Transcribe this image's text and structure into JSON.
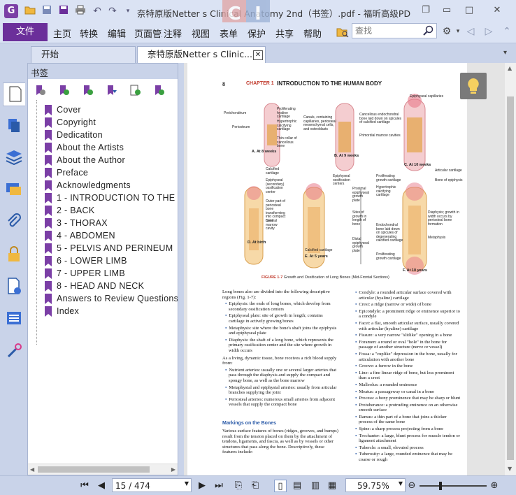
{
  "window": {
    "title": "奈特原版Netter s Clinical Anatomy 2nd（书签）.pdf - 福昕高级PDF编...",
    "watermark": [
      "C",
      "I"
    ]
  },
  "menu": {
    "file": "文件",
    "items": [
      "主页",
      "转换",
      "编辑",
      "页面管理",
      "注释",
      "视图",
      "表单",
      "保护",
      "共享",
      "帮助"
    ],
    "search_placeholder": "查找"
  },
  "tabs": [
    {
      "label": "开始",
      "active": false
    },
    {
      "label": "奈特原版Netter s Clinic...",
      "active": true
    }
  ],
  "bookmarks_panel": {
    "title": "书签",
    "items": [
      "Cover",
      "Copyright",
      "Dedicatiton",
      "About the Artists",
      "About the Author",
      "Preface",
      "Acknowledgments",
      "1 - INTRODUCTION TO THE HU",
      "2 - BACK",
      "3 - THORAX",
      "4 - ABDOMEN",
      "5 - PELVIS AND PERINEUM",
      "6 - LOWER LIMB",
      "7 - UPPER LIMB",
      "8 - HEAD AND NECK",
      "Answers to Review Questions",
      "Index"
    ]
  },
  "page": {
    "number": "8",
    "chapter": "CHAPTER 1",
    "chapter_title": "INTRODUCTION TO THE HUMAN BODY",
    "figure_caption_label": "FIGURE 1-7",
    "figure_caption": " Growth and Ossification of Long Bones (Mid-Frontal Sections)",
    "fig_labels": {
      "a": "A. At 8 weeks",
      "b": "B. At 9 weeks",
      "c": "C. At 10 weeks",
      "d": "D. At birth",
      "e": "E. At 5 years",
      "f": "F. At 10 years",
      "perichondrium": "Perichondrium",
      "periosteum": "Periosteum",
      "prolif": "Proliferating hyaline cartilage",
      "hyper": "Hypertrophic calcifying cartilage",
      "thincollar": "Thin collar of cancellous bone",
      "canals": "Canals, containing capillaries, periosteal mesenchymal cells, and osteoblasts",
      "cancellous": "Cancellous endochondral bone laid down on spicules of calcified cartilage",
      "primordial": "Primordial marrow cavities",
      "epicap": "Epiphyseal capillaries",
      "calcified": "Calcified cartilage",
      "epicenter": "Epiphyseal (secondary) ossification center",
      "outer": "Outer part of periosteal bone transforming into compact bone",
      "central": "Central marrow cavity",
      "epiossif": "Epiphyseal ossification centers",
      "proximal": "Proximal epiphyseal growth plate",
      "sites": "Sites of growth in length of bone",
      "distal": "Distal epiphyseal growth plate",
      "endo": "Endochondral bone laid down on spicules of degenerating calcified cartilage",
      "prolifgrowth": "Proliferating growth cartilage",
      "hypercalc": "Hypertrophic calcifying cartilage",
      "artcart": "Articular cartilage",
      "boneepi": "Bone of epiphysis",
      "diaphysis": "Diaphysis; growth in width occurs by periosteal bone formation",
      "metaphysis": "Metaphysis",
      "calc5": "Calcified cartilage",
      "prolif10": "Proliferating growth cartilage"
    },
    "left_col": {
      "intro": "Long bones also are divided into the following descriptive regions (Fig. 1-7):",
      "bullets": [
        "Epiphysis: the ends of long bones, which develop from secondary ossification centers",
        "Epiphyseal plate: site of growth in length; contains cartilage in actively growing bones",
        "Metaphysis: site where the bone's shaft joins the epiphysis and epiphyseal plate",
        "Diaphysis: the shaft of a long bone, which represents the primary ossification center and the site where growth in width occurs"
      ],
      "para2": "As a living, dynamic tissue, bone receives a rich blood supply from:",
      "bullets2": [
        "Nutrient arteries: usually one or several larger arteries that pass through the diaphysis and supply the compact and spongy bone, as well as the bone marrow",
        "Metaphysial and epiphysial arteries: usually from articular branches supplying the joint",
        "Periosteal arteries: numerous small arteries from adjacent vessels that supply the compact bone"
      ],
      "subhead": "Markings on the Bones",
      "para3": "Various surface features of bones (ridges, grooves, and bumps) result from the tension placed on them by the attachment of tendons, ligaments, and fascia, as well as by vessels or other structures that pass along the bone. Descriptively, these features include:"
    },
    "right_col": [
      "Condyle: a rounded articular surface covered with articular (hyaline) cartilage",
      "Crest: a ridge (narrow or wide) of bone",
      "Epicondyle: a prominent ridge or eminence superior to a condyle",
      "Facet: a flat, smooth articular surface, usually covered with articular (hyaline) cartilage",
      "Fissure: a very narrow \"slitlike\" opening in a bone",
      "Foramen: a round or oval \"hole\" in the bone for passage of another structure (nerve or vessel)",
      "Fossa: a \"cuplike\" depression in the bone, usually for articulation with another bone",
      "Groove: a furrow in the bone",
      "Line: a fine linear ridge of bone, but less prominent than a crest",
      "Malleolus: a rounded eminence",
      "Meatus: a passageway or canal in a bone",
      "Process: a bony prominence that may be sharp or blunt",
      "Protuberance: a protruding eminence on an otherwise smooth surface",
      "Ramus: a thin part of a bone that joins a thicker process of the same bone",
      "Spine: a sharp process projecting from a bone",
      "Trochanter: a large, blunt process for muscle tendon or ligament attachment",
      "Tubercle: a small, elevated process",
      "Tuberosity: a large, rounded eminence that may be coarse or rough"
    ]
  },
  "status": {
    "page_input": "15 / 474",
    "zoom": "59.75%",
    "zoom_fraction": 0.3
  },
  "colors": {
    "accent": "#6b2f9a",
    "chrome": "#c9d3e9",
    "chapter_red": "#c0392b",
    "link_blue": "#2a5aa8"
  }
}
